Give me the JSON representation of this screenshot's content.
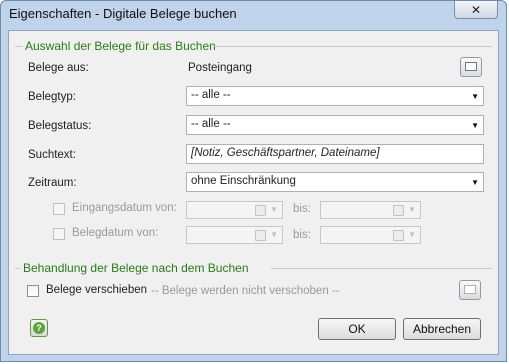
{
  "window": {
    "title": "Eigenschaften - Digitale Belege buchen",
    "close_glyph": "✕"
  },
  "group_selection": {
    "title": "Auswahl der Belege für das Buchen",
    "belege_aus": {
      "label": "Belege aus:",
      "value": "Posteingang"
    },
    "belegtyp": {
      "label": "Belegtyp:",
      "value": "-- alle --"
    },
    "belegstatus": {
      "label": "Belegstatus:",
      "value": "-- alle --"
    },
    "suchtext": {
      "label": "Suchtext:",
      "value": "[Notiz, Geschäftspartner, Dateiname]"
    },
    "zeitraum": {
      "label": "Zeitraum:",
      "value": "ohne Einschränkung"
    },
    "eingangsdatum": {
      "label": "Eingangsdatum von:",
      "to_label": "bis:"
    },
    "belegdatum": {
      "label": "Belegdatum von:",
      "to_label": "bis:"
    }
  },
  "group_after": {
    "title": "Behandlung der Belege nach dem Buchen",
    "checkbox_label": "Belege verschieben",
    "status_text": "-- Belege werden nicht verschoben --"
  },
  "footer": {
    "help_glyph": "?",
    "ok_label": "OK",
    "cancel_label": "Abbrechen"
  }
}
